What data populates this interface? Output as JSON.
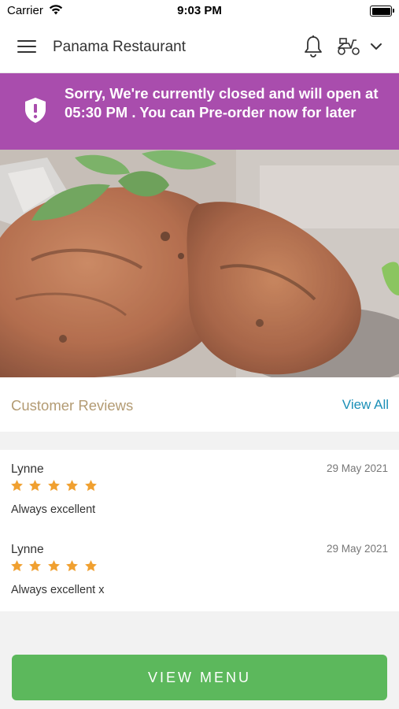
{
  "status_bar": {
    "carrier": "Carrier",
    "time": "9:03 PM"
  },
  "header": {
    "title": "Panama Restaurant",
    "icons": [
      "menu-icon",
      "bell-icon",
      "scooter-icon",
      "chevron-down-icon"
    ]
  },
  "banner": {
    "message": "Sorry, We're currently closed and will open at 05:30 PM . You can Pre-order now for later",
    "color": "#a94dad",
    "icon": "shield-alert-icon"
  },
  "reviews_section": {
    "title": "Customer Reviews",
    "view_all": "View All",
    "items": [
      {
        "name": "Lynne",
        "date": "29 May 2021",
        "rating": 5,
        "text": "Always excellent"
      },
      {
        "name": "Lynne",
        "date": "29 May 2021",
        "rating": 5,
        "text": "Always excellent x"
      }
    ]
  },
  "view_menu_button": {
    "label": "VIEW MENU",
    "color": "#5cb85c"
  },
  "colors": {
    "star": "#f0a030",
    "link": "#1b8fb7",
    "reviews_title": "#b39b73"
  }
}
